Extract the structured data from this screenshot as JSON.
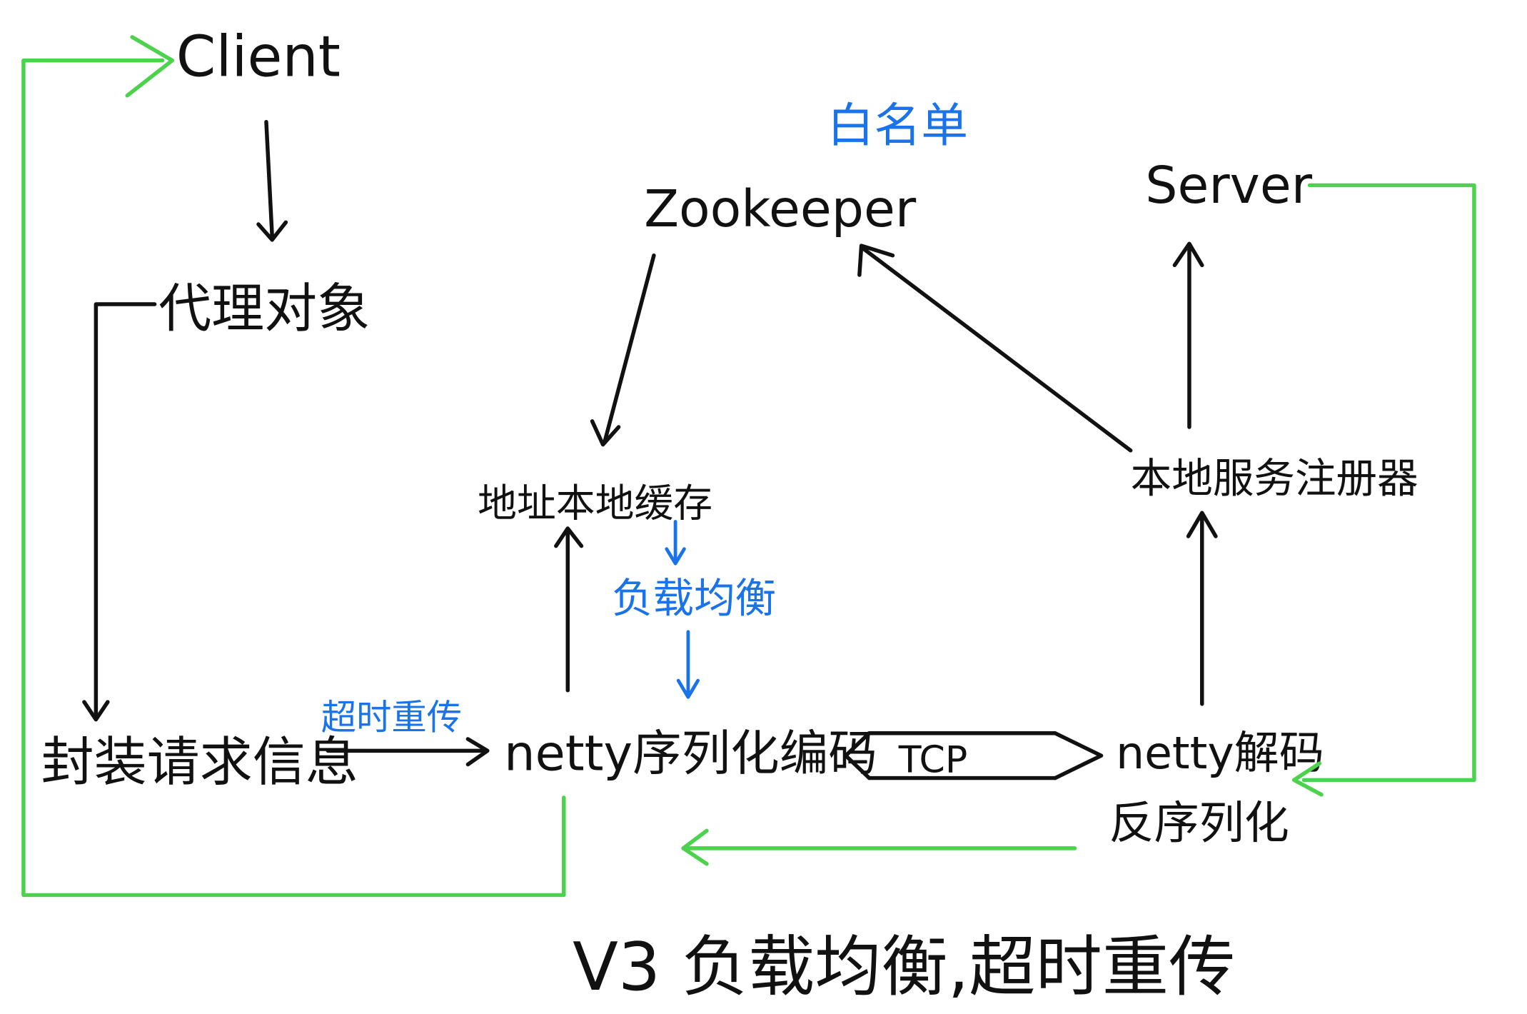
{
  "nodes": {
    "client": "Client",
    "proxy": "代理对象",
    "package_request": "封装请求信息",
    "netty_encode": "netty序列化编码",
    "address_cache": "地址本地缓存",
    "zookeeper": "Zookeeper",
    "server": "Server",
    "local_registry": "本地服务注册器",
    "netty_decode": "netty解码",
    "deserialize": "反序列化"
  },
  "annotations": {
    "whitelist": "白名单",
    "load_balance": "负载均衡",
    "timeout_retry": "超时重传",
    "tcp": "TCP"
  },
  "title": "V3  负载均衡,超时重传",
  "colors": {
    "ink": "#111111",
    "annotation_blue": "#1a73e8",
    "flow_green": "#4cd24c"
  }
}
